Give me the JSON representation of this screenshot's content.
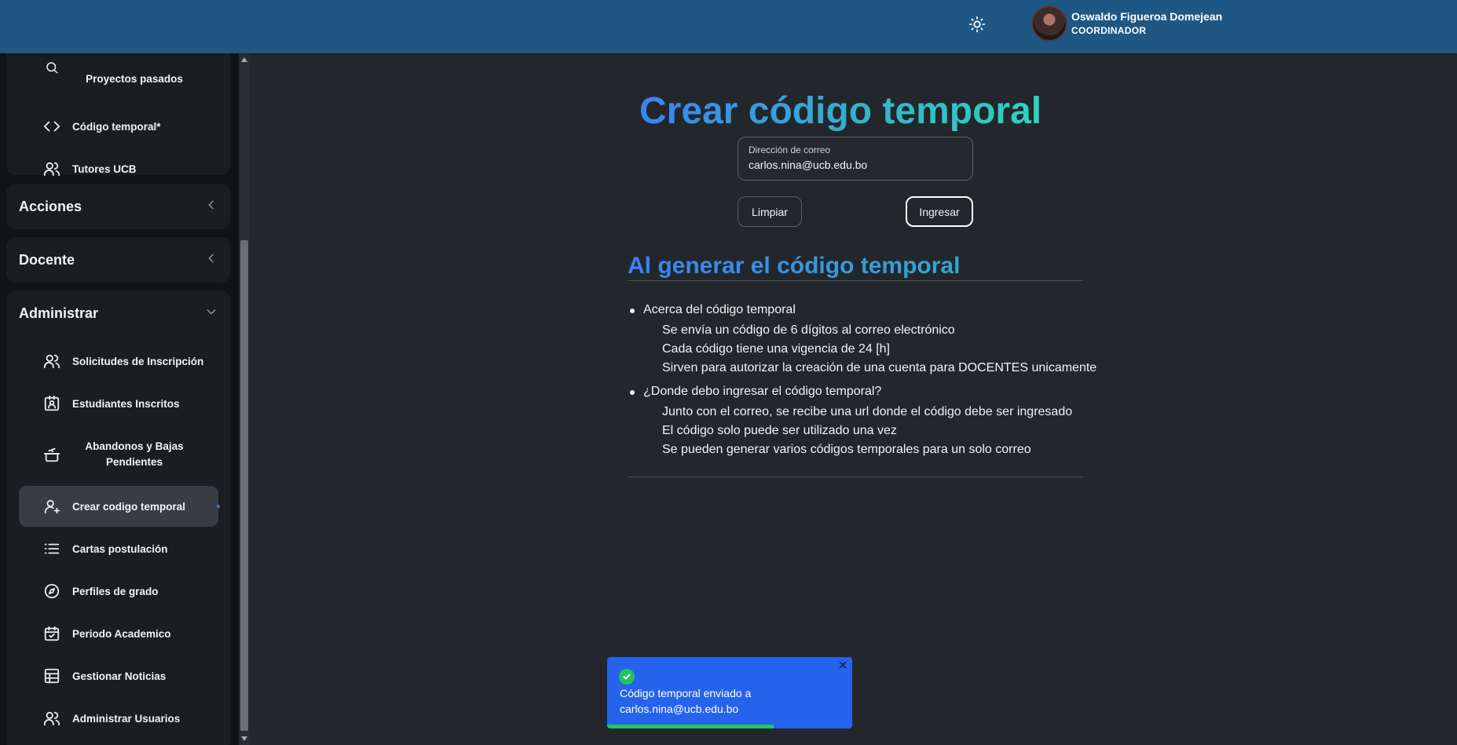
{
  "header": {
    "user_name": "Oswaldo Figueroa Domejean",
    "user_role": "COORDINADOR"
  },
  "sidebar": {
    "top_items": [
      {
        "label": "Proyectos pasados",
        "icon": "search-icon"
      },
      {
        "label": "Código temporal*",
        "icon": "code-icon"
      },
      {
        "label": "Tutores UCB",
        "icon": "users-icon"
      }
    ],
    "sections": {
      "acciones": "Acciones",
      "docente": "Docente",
      "administrar": "Administrar"
    },
    "admin_items": [
      {
        "label": "Solicitudes de Inscripción",
        "icon": "users-icon"
      },
      {
        "label": "Estudiantes Inscritos",
        "icon": "id-badge-icon"
      },
      {
        "label": "Abandonos y Bajas Pendientes",
        "icon": "pot-icon"
      },
      {
        "label": "Crear codigo temporal",
        "icon": "user-plus-icon",
        "active": true
      },
      {
        "label": "Cartas postulación",
        "icon": "list-icon"
      },
      {
        "label": "Perfiles de grado",
        "icon": "compass-icon"
      },
      {
        "label": "Periodo Academico",
        "icon": "calendar-check-icon"
      },
      {
        "label": "Gestionar Noticias",
        "icon": "table-icon"
      },
      {
        "label": "Administrar Usuarios",
        "icon": "users-icon"
      }
    ]
  },
  "main": {
    "title": "Crear código temporal",
    "email_label": "Dirección de correo",
    "email_value": "carlos.nina@ucb.edu.bo",
    "clear_label": "Limpiar",
    "submit_label": "Ingresar",
    "info_title": "Al generar el código temporal",
    "info": [
      {
        "question": "Acerca del código temporal",
        "lines": [
          "Se envía un código de 6 dígitos al correo electrónico",
          "Cada código tiene una vigencia de 24 [h]",
          "Sirven para autorizar la creación de una cuenta para DOCENTES unicamente"
        ]
      },
      {
        "question": "¿Donde debo ingresar el código temporal?",
        "lines": [
          "Junto con el correo, se recibe una url donde el código debe ser ingresado",
          "El código solo puede ser utilizado una vez",
          "Se pueden generar varios códigos temporales para un solo correo"
        ]
      }
    ]
  },
  "toast": {
    "message": "Código temporal enviado a carlos.nina@ucb.edu.bo",
    "progress": 0.68,
    "status_color": "#22c55e",
    "bg_color": "#2563eb"
  }
}
